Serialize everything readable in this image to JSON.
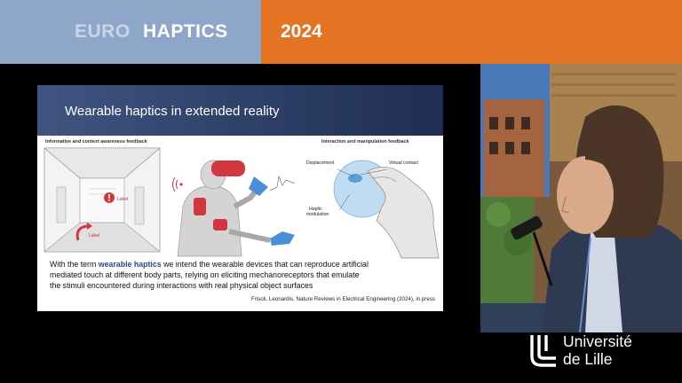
{
  "banner": {
    "left_word": "EURO",
    "right_word": "HAPTICS",
    "year": "2024",
    "left_color": "#8ea6c8",
    "right_color": "#e27424"
  },
  "slide": {
    "title": "Wearable haptics in extended reality",
    "panel_left_label": "Informative and context awareness feedback",
    "panel_right_label": "Interaction and manipulation feedback",
    "fig_labels": {
      "label_a": "Label",
      "label_b": "Label",
      "displacement": "Displacement",
      "virtual_contact": "Virtual contact",
      "haptic_modulation_1": "Haptic",
      "haptic_modulation_2": "modulation"
    },
    "body_prefix": "With the term ",
    "body_highlight": "wearable haptics",
    "body_line1_rest": " we intend the wearable devices that can reproduce artificial",
    "body_line2": "mediated touch at different body parts, relying on eliciting mechanoreceptors that emulate",
    "body_line3": "the stimuli encountered during interactions with real physical object surfaces",
    "citation": "Frisoli, Leonardis, Nature Reviews in Electrical Engineering (2024), in press"
  },
  "logo": {
    "line1": "Université",
    "line2": "de Lille",
    "icon": "universite-de-lille-logo-icon"
  }
}
